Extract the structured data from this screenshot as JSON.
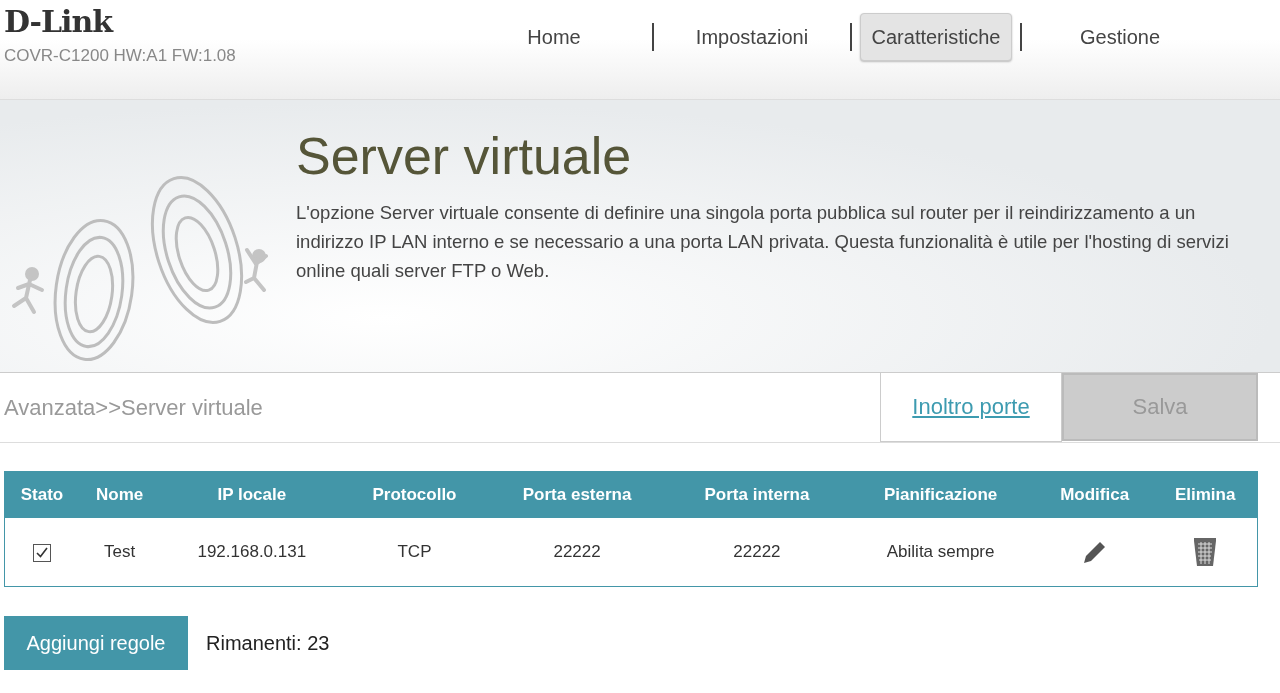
{
  "header": {
    "logo": "D-Link",
    "device_info": "COVR-C1200 HW:A1 FW:1.08"
  },
  "nav": [
    {
      "label": "Home",
      "selected": false
    },
    {
      "label": "Impostazioni",
      "selected": false
    },
    {
      "label": "Caratteristiche",
      "selected": true
    },
    {
      "label": "Gestione",
      "selected": false
    }
  ],
  "banner": {
    "title": "Server virtuale",
    "description": "L'opzione Server virtuale consente di definire una singola porta pubblica sul router per il reindirizzamento a un indirizzo IP LAN interno e se necessario a una porta LAN privata. Questa funzionalità è utile per l'hosting di servizi online quali server FTP o Web."
  },
  "toolbar": {
    "breadcrumb": "Avanzata>>Server virtuale",
    "link": "Inoltro porte",
    "save_button": {
      "label": "Salva",
      "disabled": true
    }
  },
  "table": {
    "columns": [
      "Stato",
      "Nome",
      "IP locale",
      "Protocollo",
      "Porta esterna",
      "Porta interna",
      "Pianificazione",
      "Modifica",
      "Elimina"
    ],
    "rows": [
      {
        "checked": true,
        "cells": [
          "",
          "Test",
          "192.168.0.131",
          "TCP",
          "22222",
          "22222",
          "Abilita sempre",
          "",
          ""
        ]
      }
    ]
  },
  "footer": {
    "add_button": "Aggiungi regole",
    "remaining": "Rimanenti: 23"
  }
}
